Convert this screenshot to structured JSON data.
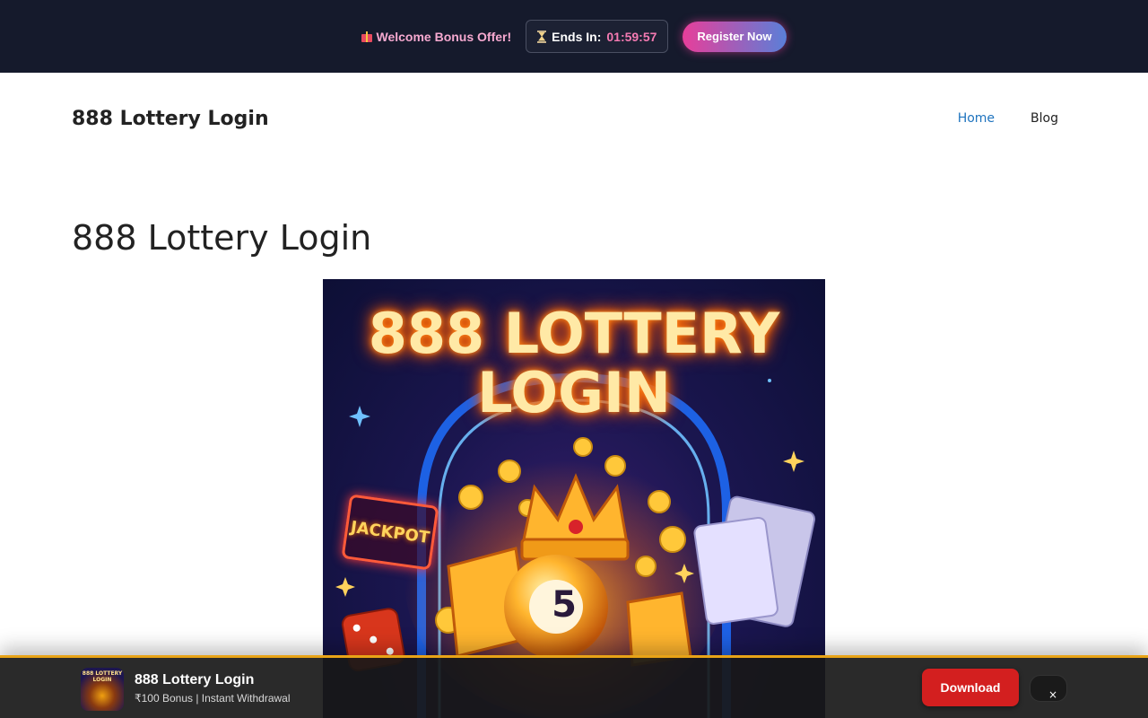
{
  "promo": {
    "offer_text": "Welcome Bonus Offer!",
    "timer_label": "Ends In:",
    "timer_value": "01:59:57",
    "register_label": "Register Now"
  },
  "header": {
    "site_title": "888 Lottery Login",
    "nav": [
      {
        "label": "Home",
        "active": true
      },
      {
        "label": "Blog",
        "active": false
      }
    ]
  },
  "main": {
    "heading": "888 Lottery Login",
    "hero": {
      "title_line1": "888 LOTTERY",
      "title_line2": "LOGIN",
      "jackpot_text": "JACKPOT",
      "ball_number": "5"
    }
  },
  "app_banner": {
    "icon_text": "888 LOTTERY LOGIN",
    "app_name": "888 Lottery Login",
    "tagline": "₹100 Bonus | Instant Withdrawal",
    "download_label": "Download",
    "close_label": "×"
  },
  "colors": {
    "promo_bg": "#151a2c",
    "nav_active": "#1e73be",
    "download_red": "#d31f1f",
    "banner_border": "#e8a317"
  },
  "icons": [
    "gift-icon",
    "hourglass-icon",
    "close-icon"
  ]
}
